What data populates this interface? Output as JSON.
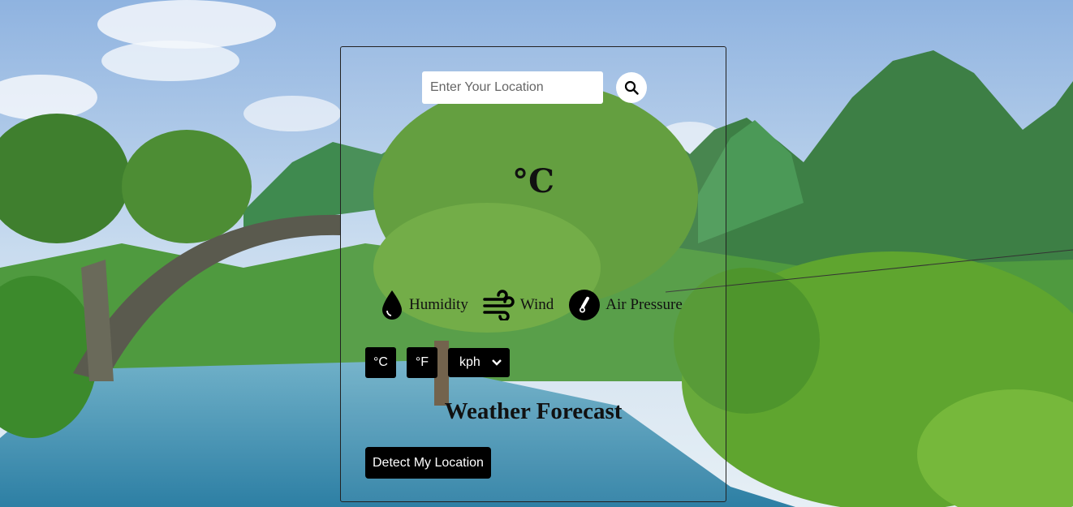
{
  "search": {
    "placeholder": "Enter Your Location",
    "icon": "search-icon"
  },
  "current": {
    "temperature_unit": "°C"
  },
  "stats": [
    {
      "icon": "droplet-icon",
      "label": "Humidity"
    },
    {
      "icon": "wind-icon",
      "label": "Wind"
    },
    {
      "icon": "thermometer-gauge-icon",
      "label": "Air Pressure"
    }
  ],
  "units": {
    "celsius": "°C",
    "fahrenheit": "°F",
    "speed": "kph"
  },
  "forecast": {
    "title": "Weather Forecast"
  },
  "actions": {
    "detect": "Detect My Location"
  },
  "colors": {
    "button_bg": "#000000",
    "button_text": "#ffffff"
  }
}
